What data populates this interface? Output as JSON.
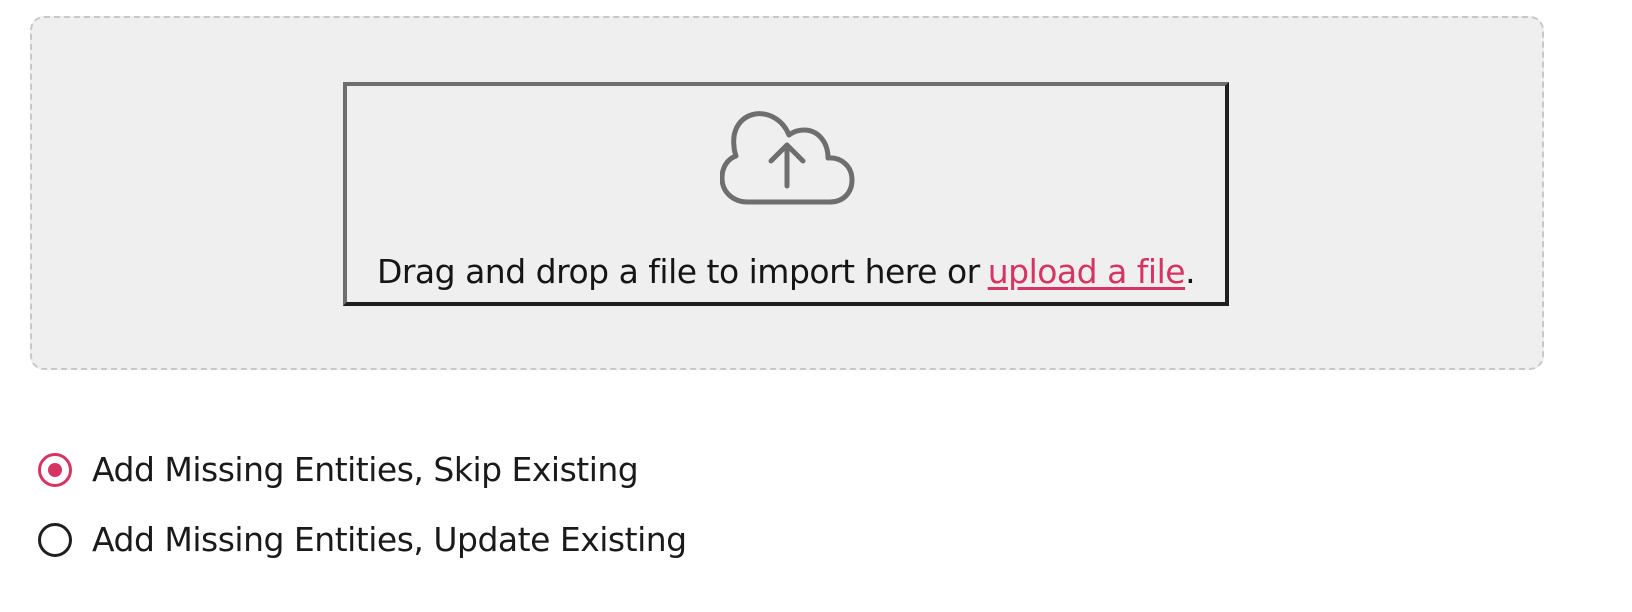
{
  "dropzone": {
    "icon": "cloud-upload-icon",
    "text_before": "Drag and drop a file to import here or",
    "link_label": "upload a file",
    "text_after": "."
  },
  "import_mode": {
    "selected_index": 0,
    "options": [
      {
        "label": "Add Missing Entities, Skip Existing",
        "checked": true
      },
      {
        "label": "Add Missing Entities, Update Existing",
        "checked": false
      }
    ]
  },
  "colors": {
    "accent": "#d63462",
    "dropzone_bg": "#efefef",
    "dropzone_border": "#c8c8c8",
    "icon": "#6e6e6e"
  }
}
